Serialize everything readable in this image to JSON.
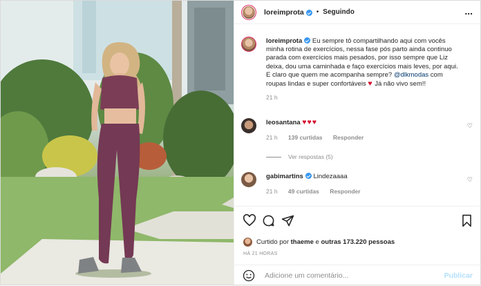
{
  "header": {
    "username": "loreimprota",
    "follow_status": "Seguindo",
    "separator": "•",
    "more": "..."
  },
  "caption": {
    "username": "loreimprota",
    "text_part1": "Eu sempre tô compartilhando aqui com vocês minha rotina de exercícios, nessa fase pós parto ainda continuo parada com exercícios mais pesados, por isso sempre que Liz deixa, dou uma caminhada e faço exercícios mais leves, por aqui.",
    "text_part2": "E claro que quem me acompanha sempre?",
    "mention": "@dlkmodas",
    "text_part3": "com roupas lindas e super confortáveis",
    "text_part4": "Já não vivo sem!!",
    "time": "21 h"
  },
  "comments": [
    {
      "username": "leosantana",
      "emoji": "♥♥♥",
      "time": "21 h",
      "likes": "139 curtidas",
      "reply": "Responder",
      "view_replies": "Ver respostas (5)"
    },
    {
      "username": "gabimartins",
      "text": "Lindezaaaa",
      "time": "21 h",
      "likes": "49 curtidas",
      "reply": "Responder"
    }
  ],
  "likes": {
    "prefix": "Curtido por",
    "user": "thaeme",
    "middle": "e",
    "others": "outras 173.220 pessoas"
  },
  "time_ago": "HÁ 21 HORAS",
  "add_comment": {
    "placeholder": "Adicione um comentário...",
    "publish": "Publicar"
  },
  "colors": {
    "link": "#00376b",
    "verified": "#3897f0",
    "muted": "#8e8e8e",
    "publish_disabled": "#b2dffc"
  },
  "icons": [
    "heart-icon",
    "comment-icon",
    "share-icon",
    "save-icon",
    "smile-icon",
    "more-icon"
  ]
}
